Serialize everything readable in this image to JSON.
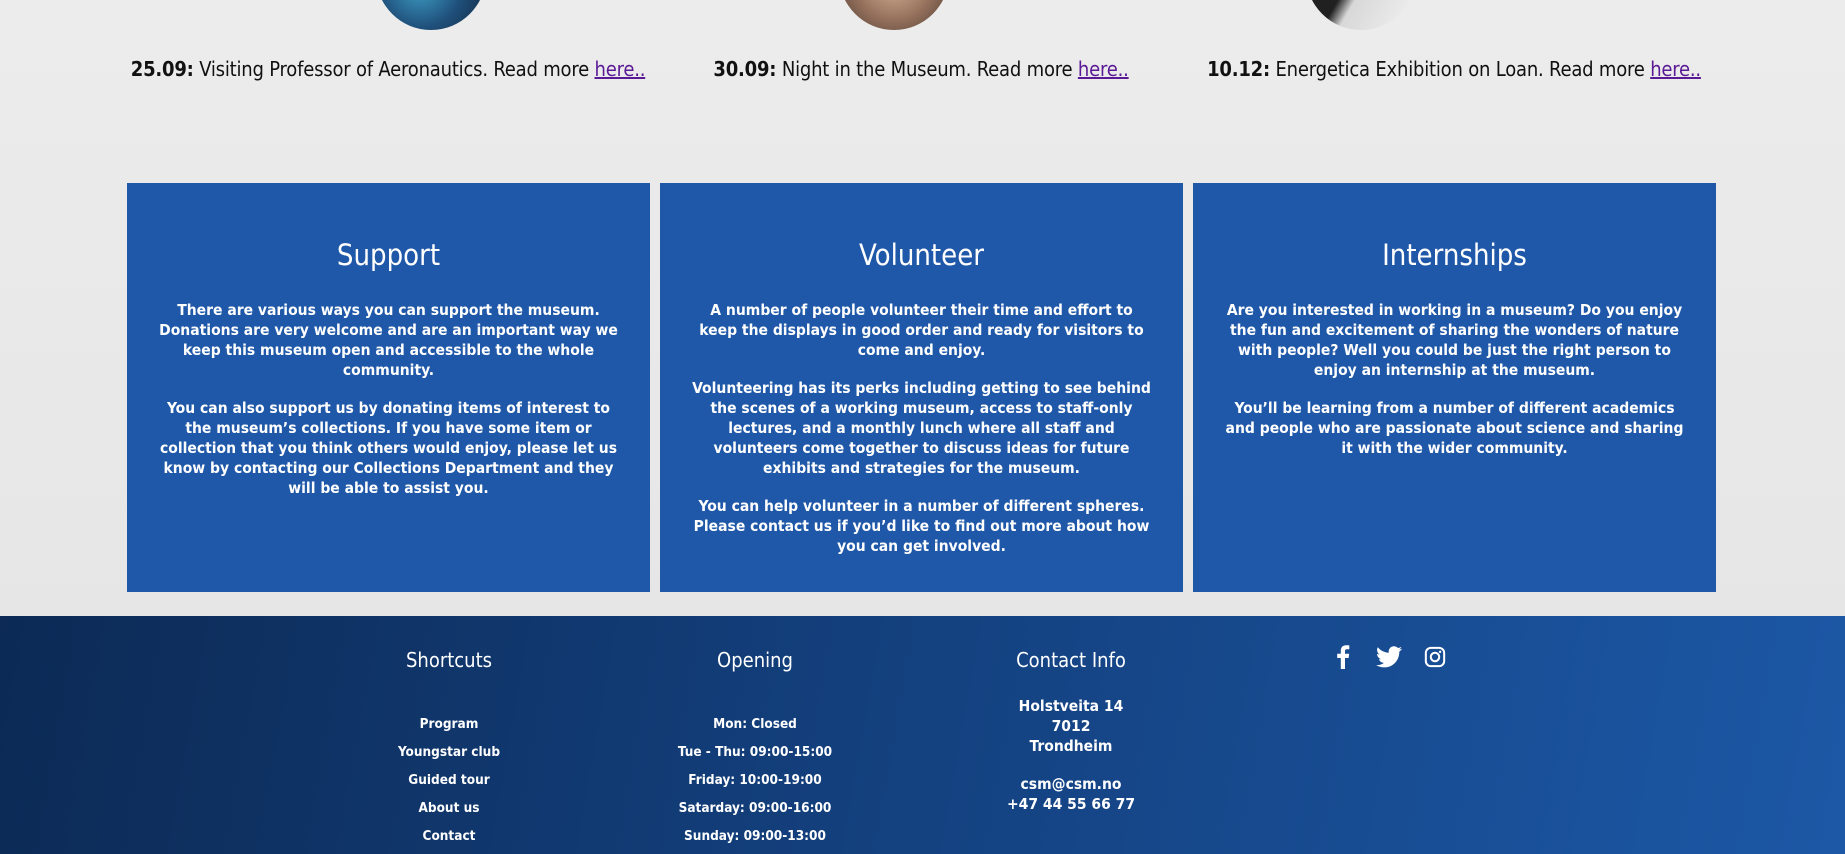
{
  "news": [
    {
      "date": "25.09:",
      "text": "Visiting Professor of Aeronautics. Read more ",
      "link": "here.."
    },
    {
      "date": "30.09:",
      "text": "Night in the Museum. Read more ",
      "link": "here.."
    },
    {
      "date": "10.12:",
      "text": "Energetica Exhibition on Loan. Read more ",
      "link": "here.."
    }
  ],
  "cards": [
    {
      "title": "Support",
      "paragraphs": [
        "There are various ways you can support the museum. Donations are very welcome and are an important way we keep this museum open and accessible to the whole community.",
        "You can also support us by donating items of interest to the museum’s collections. If you have some item or collection that you think others would enjoy, please let us know by contacting our Collections Department and they will be able to assist you."
      ]
    },
    {
      "title": "Volunteer",
      "paragraphs": [
        "A number of people volunteer their time and effort to keep the displays in good order and ready for visitors to come and enjoy.",
        "Volunteering has its perks including getting to see behind the scenes of a working museum, access to staff-only lectures, and a monthly lunch where all staff and volunteers come together to discuss ideas for future exhibits and strategies for the museum.",
        "You can help volunteer in a number of different spheres. Please contact us if you’d like to find out more about how you can get involved."
      ]
    },
    {
      "title": "Internships",
      "paragraphs": [
        "Are you interested in working in a museum? Do you enjoy the fun and excitement of sharing the wonders of nature with people? Well you could be just the right person to enjoy an internship at the museum.",
        "You’ll be learning from a number of different academics and people who are passionate about science and sharing it with the wider community."
      ]
    }
  ],
  "footer": {
    "shortcuts": {
      "heading": "Shortcuts",
      "items": [
        "Program",
        "Youngstar club",
        "Guided tour",
        "About us",
        "Contact"
      ]
    },
    "opening": {
      "heading": "Opening",
      "items": [
        "Mon: Closed",
        "Tue - Thu: 09:00-15:00",
        "Friday: 10:00-19:00",
        "Satarday: 09:00-16:00",
        "Sunday: 09:00-13:00"
      ]
    },
    "contact": {
      "heading": "Contact Info",
      "street": "Holstveita 14",
      "postcode": "7012",
      "city": "Trondheim",
      "email": "csm@csm.no",
      "phone": "+47 44 55 66 77"
    },
    "social": [
      {
        "name": "facebook-icon"
      },
      {
        "name": "twitter-icon"
      },
      {
        "name": "instagram-icon"
      }
    ]
  },
  "colors": {
    "card_blue": "#1f58a8",
    "footer_dark": "#0c2a55",
    "footer_light": "#1c58a6",
    "link_visited": "#5b1a95"
  }
}
